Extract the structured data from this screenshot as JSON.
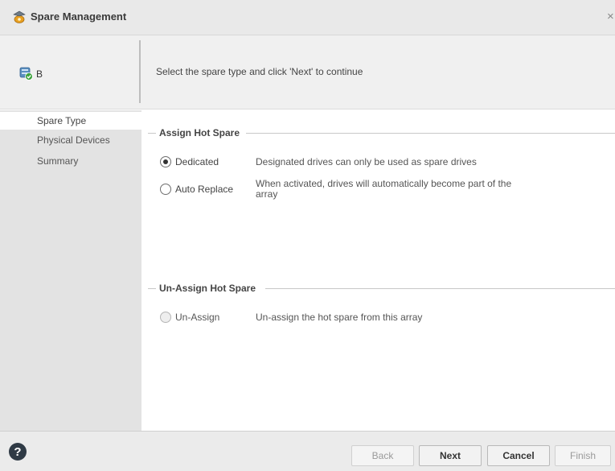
{
  "window": {
    "title": "Spare Management",
    "close_glyph": "×",
    "title_icon": "spare-management-icon"
  },
  "header": {
    "array_name": "B",
    "array_icon": "array-status-icon",
    "instruction": "Select the spare type and click 'Next' to continue"
  },
  "sidebar": {
    "items": [
      {
        "label": "Spare Type",
        "selected": true
      },
      {
        "label": "Physical Devices",
        "selected": false
      },
      {
        "label": "Summary",
        "selected": false
      }
    ]
  },
  "assign": {
    "title": "Assign Hot Spare",
    "options": [
      {
        "label": "Dedicated",
        "description": "Designated drives can only be used as spare drives",
        "checked": true
      },
      {
        "label": "Auto Replace",
        "description_line1": "When activated, drives will automatically become part of the",
        "description_line2": "array",
        "checked": false
      }
    ]
  },
  "unassign": {
    "title": "Un-Assign Hot Spare",
    "option": {
      "label": "Un-Assign",
      "description": "Un-assign the hot spare from this array",
      "checked": false,
      "enabled": false
    }
  },
  "footer": {
    "help_glyph": "?",
    "help_icon": "help-icon",
    "back_label": "Back",
    "next_label": "Next",
    "cancel_label": "Cancel",
    "finish_label": "Finish"
  }
}
